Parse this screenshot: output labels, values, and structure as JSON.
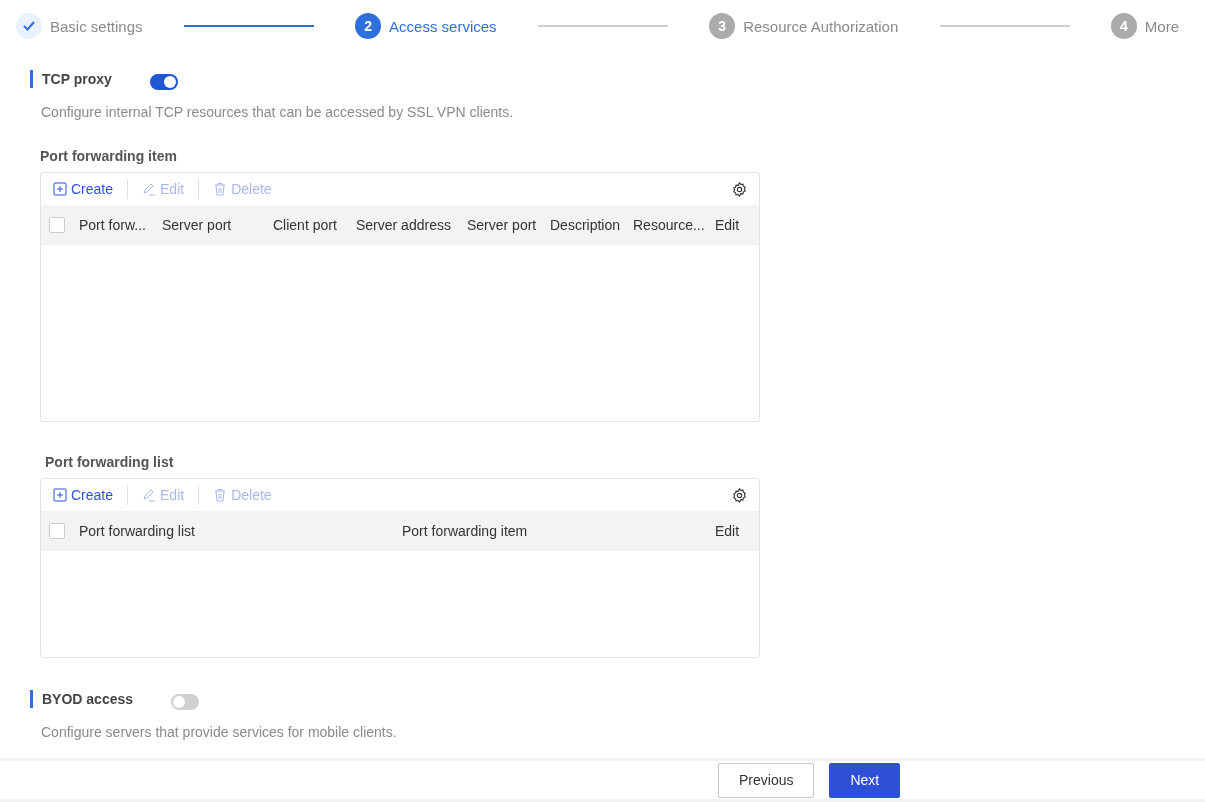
{
  "steps": [
    {
      "label": "Basic settings",
      "kind": "done"
    },
    {
      "number": "2",
      "label": "Access services",
      "kind": "active"
    },
    {
      "number": "3",
      "label": "Resource Authorization",
      "kind": "pending"
    },
    {
      "number": "4",
      "label": "More",
      "kind": "pending"
    }
  ],
  "sections": [
    {
      "title": "TCP proxy",
      "on": true,
      "description": "Configure internal TCP resources that can be accessed by SSL VPN clients.",
      "tables": [
        {
          "title": "Port forwarding item",
          "toolbar": [
            {
              "label": "Create",
              "kind": "create",
              "disabled": false
            },
            {
              "label": "Edit",
              "kind": "edit",
              "disabled": true
            },
            {
              "label": "Delete",
              "kind": "delete",
              "disabled": true
            }
          ],
          "select_all": {
            "checked": false
          },
          "columns": [
            "Port forw...",
            "Server port",
            "Client port",
            "Server address",
            "Server port",
            "Description",
            "Resource...",
            "Edit"
          ]
        },
        {
          "title": "Port forwarding list",
          "toolbar": [
            {
              "label": "Create",
              "kind": "create",
              "disabled": false
            },
            {
              "label": "Edit",
              "kind": "edit",
              "disabled": true
            },
            {
              "label": "Delete",
              "kind": "delete",
              "disabled": true
            }
          ],
          "select_all": {
            "checked": false
          },
          "columns": [
            "Port forwarding list",
            "Port forwarding item",
            "Edit"
          ]
        }
      ]
    },
    {
      "title": "BYOD access",
      "on": false,
      "description": "Configure servers that provide services for mobile clients."
    }
  ],
  "footer": {
    "buttons": [
      {
        "label": "Previous",
        "kind": "secondary"
      },
      {
        "label": "Next",
        "kind": "primary"
      }
    ]
  }
}
